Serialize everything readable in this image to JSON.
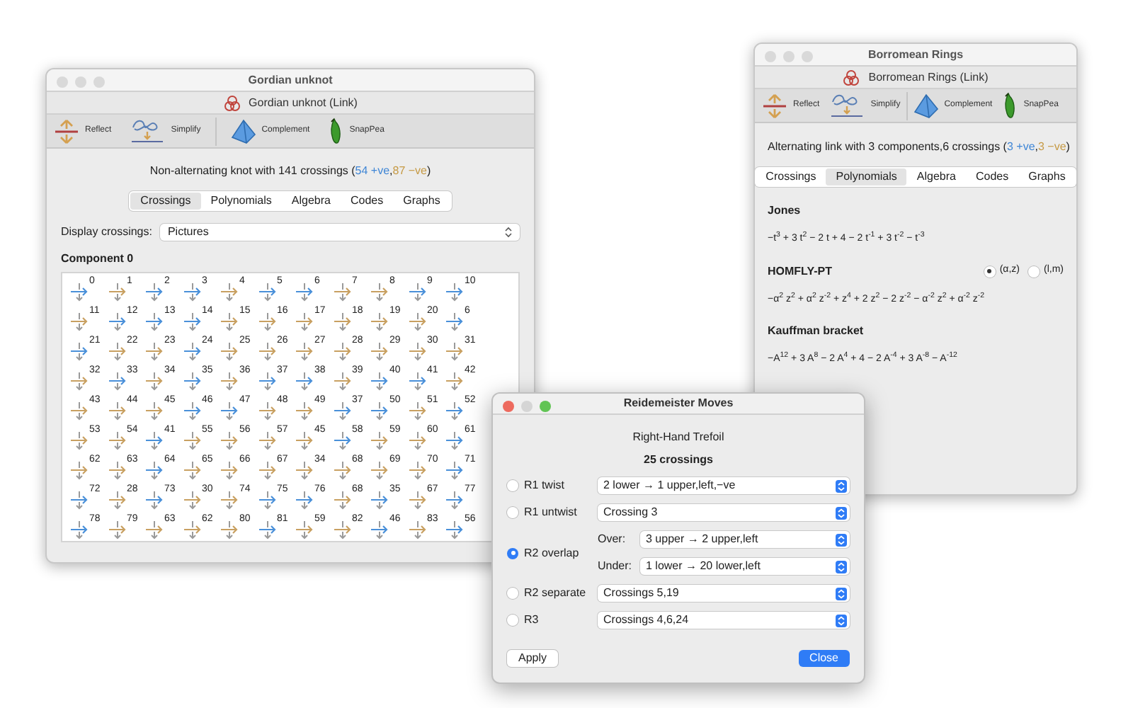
{
  "gordian_window": {
    "title": "Gordian unknot",
    "active": false,
    "subtitle": "Gordian unknot (Link)",
    "toolbar": [
      {
        "kind": "reflect",
        "label": "Reflect"
      },
      {
        "kind": "simplify",
        "label": "Simplify"
      },
      {
        "kind": "complement",
        "label": "Complement"
      },
      {
        "kind": "snappea",
        "label": "SnapPea"
      }
    ],
    "summary": {
      "text": "Non-alternating knot with 141 crossings (",
      "positive": "54 +ve",
      "separator": ",",
      "negative": "87 −ve",
      "close": ")"
    },
    "tabs": [
      {
        "label": "Crossings",
        "selected": true
      },
      {
        "label": "Polynomials",
        "selected": false
      },
      {
        "label": "Algebra",
        "selected": false
      },
      {
        "label": "Codes",
        "selected": false
      },
      {
        "label": "Graphs",
        "selected": false
      }
    ],
    "display_crossings": {
      "label": "Display crossings:",
      "value": "Pictures"
    },
    "component_heading": "Component 0",
    "crossings": [
      {
        "label": "0",
        "color": "#4a90d9"
      },
      {
        "label": "1",
        "color": "#c8a061"
      },
      {
        "label": "2",
        "color": "#4a90d9"
      },
      {
        "label": "3",
        "color": "#4a90d9"
      },
      {
        "label": "4",
        "color": "#c8a061"
      },
      {
        "label": "5",
        "color": "#4a90d9"
      },
      {
        "label": "6",
        "color": "#4a90d9"
      },
      {
        "label": "7",
        "color": "#c8a061"
      },
      {
        "label": "8",
        "color": "#c8a061"
      },
      {
        "label": "9",
        "color": "#4a90d9"
      },
      {
        "label": "10",
        "color": "#4a90d9"
      },
      {
        "label": "11",
        "color": "#c8a061"
      },
      {
        "label": "12",
        "color": "#4a90d9"
      },
      {
        "label": "13",
        "color": "#4a90d9"
      },
      {
        "label": "14",
        "color": "#4a90d9"
      },
      {
        "label": "15",
        "color": "#c8a061"
      },
      {
        "label": "16",
        "color": "#c8a061"
      },
      {
        "label": "17",
        "color": "#c8a061"
      },
      {
        "label": "18",
        "color": "#c8a061"
      },
      {
        "label": "19",
        "color": "#c8a061"
      },
      {
        "label": "20",
        "color": "#c8a061"
      },
      {
        "label": "6",
        "color": "#4a90d9"
      },
      {
        "label": "21",
        "color": "#4a90d9"
      },
      {
        "label": "22",
        "color": "#c8a061"
      },
      {
        "label": "23",
        "color": "#c8a061"
      },
      {
        "label": "24",
        "color": "#4a90d9"
      },
      {
        "label": "25",
        "color": "#c8a061"
      },
      {
        "label": "26",
        "color": "#c8a061"
      },
      {
        "label": "27",
        "color": "#c8a061"
      },
      {
        "label": "28",
        "color": "#c8a061"
      },
      {
        "label": "29",
        "color": "#c8a061"
      },
      {
        "label": "30",
        "color": "#c8a061"
      },
      {
        "label": "31",
        "color": "#c8a061"
      },
      {
        "label": "32",
        "color": "#c8a061"
      },
      {
        "label": "33",
        "color": "#4a90d9"
      },
      {
        "label": "34",
        "color": "#c8a061"
      },
      {
        "label": "35",
        "color": "#4a90d9"
      },
      {
        "label": "36",
        "color": "#c8a061"
      },
      {
        "label": "37",
        "color": "#4a90d9"
      },
      {
        "label": "38",
        "color": "#4a90d9"
      },
      {
        "label": "39",
        "color": "#c8a061"
      },
      {
        "label": "40",
        "color": "#4a90d9"
      },
      {
        "label": "41",
        "color": "#4a90d9"
      },
      {
        "label": "42",
        "color": "#c8a061"
      },
      {
        "label": "43",
        "color": "#c8a061"
      },
      {
        "label": "44",
        "color": "#c8a061"
      },
      {
        "label": "45",
        "color": "#c8a061"
      },
      {
        "label": "46",
        "color": "#4a90d9"
      },
      {
        "label": "47",
        "color": "#4a90d9"
      },
      {
        "label": "48",
        "color": "#c8a061"
      },
      {
        "label": "49",
        "color": "#c8a061"
      },
      {
        "label": "37",
        "color": "#4a90d9"
      },
      {
        "label": "50",
        "color": "#4a90d9"
      },
      {
        "label": "51",
        "color": "#c8a061"
      },
      {
        "label": "52",
        "color": "#4a90d9"
      },
      {
        "label": "53",
        "color": "#c8a061"
      },
      {
        "label": "54",
        "color": "#c8a061"
      },
      {
        "label": "41",
        "color": "#4a90d9"
      },
      {
        "label": "55",
        "color": "#c8a061"
      },
      {
        "label": "56",
        "color": "#c8a061"
      },
      {
        "label": "57",
        "color": "#c8a061"
      },
      {
        "label": "45",
        "color": "#c8a061"
      },
      {
        "label": "58",
        "color": "#4a90d9"
      },
      {
        "label": "59",
        "color": "#c8a061"
      },
      {
        "label": "60",
        "color": "#c8a061"
      },
      {
        "label": "61",
        "color": "#4a90d9"
      },
      {
        "label": "62",
        "color": "#c8a061"
      },
      {
        "label": "63",
        "color": "#c8a061"
      },
      {
        "label": "64",
        "color": "#4a90d9"
      },
      {
        "label": "65",
        "color": "#c8a061"
      },
      {
        "label": "66",
        "color": "#c8a061"
      },
      {
        "label": "67",
        "color": "#c8a061"
      },
      {
        "label": "34",
        "color": "#c8a061"
      },
      {
        "label": "68",
        "color": "#c8a061"
      },
      {
        "label": "69",
        "color": "#c8a061"
      },
      {
        "label": "70",
        "color": "#c8a061"
      },
      {
        "label": "71",
        "color": "#4a90d9"
      },
      {
        "label": "72",
        "color": "#4a90d9"
      },
      {
        "label": "28",
        "color": "#c8a061"
      },
      {
        "label": "73",
        "color": "#4a90d9"
      },
      {
        "label": "30",
        "color": "#c8a061"
      },
      {
        "label": "74",
        "color": "#c8a061"
      },
      {
        "label": "75",
        "color": "#4a90d9"
      },
      {
        "label": "76",
        "color": "#4a90d9"
      },
      {
        "label": "68",
        "color": "#c8a061"
      },
      {
        "label": "35",
        "color": "#4a90d9"
      },
      {
        "label": "67",
        "color": "#c8a061"
      },
      {
        "label": "77",
        "color": "#4a90d9"
      },
      {
        "label": "78",
        "color": "#4a90d9"
      },
      {
        "label": "79",
        "color": "#c8a061"
      },
      {
        "label": "63",
        "color": "#c8a061"
      },
      {
        "label": "62",
        "color": "#c8a061"
      },
      {
        "label": "80",
        "color": "#c8a061"
      },
      {
        "label": "81",
        "color": "#4a90d9"
      },
      {
        "label": "59",
        "color": "#c8a061"
      },
      {
        "label": "82",
        "color": "#c8a061"
      },
      {
        "label": "46",
        "color": "#4a90d9"
      },
      {
        "label": "83",
        "color": "#c8a061"
      },
      {
        "label": "56",
        "color": "#4a90d9"
      }
    ]
  },
  "borromean_window": {
    "title": "Borromean Rings",
    "active": false,
    "subtitle": "Borromean Rings (Link)",
    "toolbar": [
      {
        "kind": "reflect",
        "label": "Reflect"
      },
      {
        "kind": "simplify",
        "label": "Simplify"
      },
      {
        "kind": "complement",
        "label": "Complement"
      },
      {
        "kind": "snappea",
        "label": "SnapPea"
      }
    ],
    "summary": {
      "text": "Alternating link with 3 components,6 crossings (",
      "positive": "3 +ve",
      "separator": ",",
      "negative": "3 −ve",
      "close": ")"
    },
    "tabs": [
      {
        "label": "Crossings",
        "selected": false
      },
      {
        "label": "Polynomials",
        "selected": true
      },
      {
        "label": "Algebra",
        "selected": false
      },
      {
        "label": "Codes",
        "selected": false
      },
      {
        "label": "Graphs",
        "selected": false
      }
    ],
    "polynomials": [
      {
        "heading": "Jones",
        "formula": "−t$^{3}$ + 3 t$^{2}$ − 2 t + 4 − 2 t$^{-1}$ + 3 t$^{-2}$ − t$^{-3}$"
      },
      {
        "heading": "HOMFLY-PT",
        "options": [
          {
            "label": "(α,z)",
            "selected": true
          },
          {
            "label": "(l,m)",
            "selected": false
          }
        ],
        "formula": "−α$^{2}$ z$^{2}$ + α$^{2}$ z$^{-2}$ + z$^{4}$ + 2 z$^{2}$ − 2 z$^{-2}$ − α$^{-2}$ z$^{2}$ + α$^{-2}$ z$^{-2}$"
      },
      {
        "heading": "Kauffman bracket",
        "formula": "−A$^{12}$ + 3 A$^{8}$ − 2 A$^{4}$ + 4 − 2 A$^{-4}$ + 3 A$^{-8}$ − A$^{-12}$"
      }
    ]
  },
  "reidemeister_dialog": {
    "title": "Reidemeister Moves",
    "active": true,
    "knot_name": "Right-Hand Trefoil",
    "crossing_count": "25 crossings",
    "moves": [
      {
        "label": "R1 twist",
        "selected": false,
        "selects": [
          {
            "value": "2 lower → 1 upper,left,−ve"
          }
        ]
      },
      {
        "label": "R1 untwist",
        "selected": false,
        "selects": [
          {
            "value": "Crossing 3"
          }
        ]
      },
      {
        "label": "R2 overlap",
        "selected": true,
        "selects": [
          {
            "label": "Over:",
            "value": "3 upper → 2 upper,left"
          },
          {
            "label": "Under:",
            "value": "1 lower → 20 lower,left"
          }
        ]
      },
      {
        "label": "R2 separate",
        "selected": false,
        "selects": [
          {
            "value": "Crossings 5,19"
          }
        ]
      },
      {
        "label": "R3",
        "selected": false,
        "selects": [
          {
            "value": "Crossings 4,6,24"
          }
        ]
      }
    ],
    "buttons": [
      {
        "label": "Apply",
        "default": false
      },
      {
        "label": "Close",
        "default": true
      }
    ]
  }
}
